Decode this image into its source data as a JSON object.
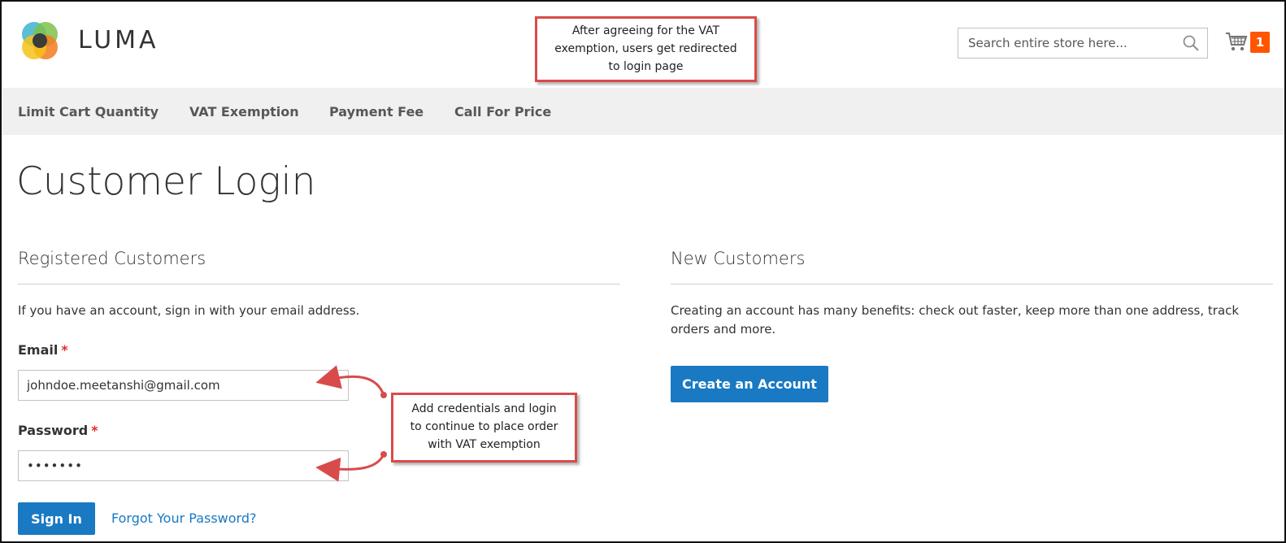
{
  "brand": {
    "name": "LUMA"
  },
  "header": {
    "search_placeholder": "Search entire store here...",
    "cart_count": "1"
  },
  "nav": {
    "items": [
      {
        "label": "Limit Cart Quantity"
      },
      {
        "label": "VAT Exemption"
      },
      {
        "label": "Payment Fee"
      },
      {
        "label": "Call For Price"
      }
    ]
  },
  "page": {
    "title": "Customer Login"
  },
  "registered": {
    "title": "Registered Customers",
    "intro": "If you have an account, sign in with your email address.",
    "email_label": "Email",
    "email_value": "johndoe.meetanshi@gmail.com",
    "password_label": "Password",
    "password_value": "•••••••",
    "required_mark": "*",
    "sign_in_label": "Sign In",
    "forgot_label": "Forgot Your Password?"
  },
  "new_customers": {
    "title": "New Customers",
    "description": "Creating an account has many benefits: check out faster, keep more than one address, track orders and more.",
    "create_label": "Create an Account"
  },
  "annotations": {
    "top_note": [
      "After agreeing for the VAT",
      "exemption, users get redirected",
      "to login page"
    ],
    "credentials_note": [
      "Add credentials and login",
      "to continue to place order",
      "with VAT exemption"
    ]
  },
  "colors": {
    "accent": "#1979c3",
    "cart_badge": "#ff5501",
    "required": "#e02b27",
    "annotation_border": "#d94b4b",
    "nav_background": "#f0f0f0"
  },
  "icons": {
    "logo": "luma-logo-icon",
    "search": "search-icon",
    "cart": "cart-icon",
    "arrow": "curved-arrow-icon"
  }
}
